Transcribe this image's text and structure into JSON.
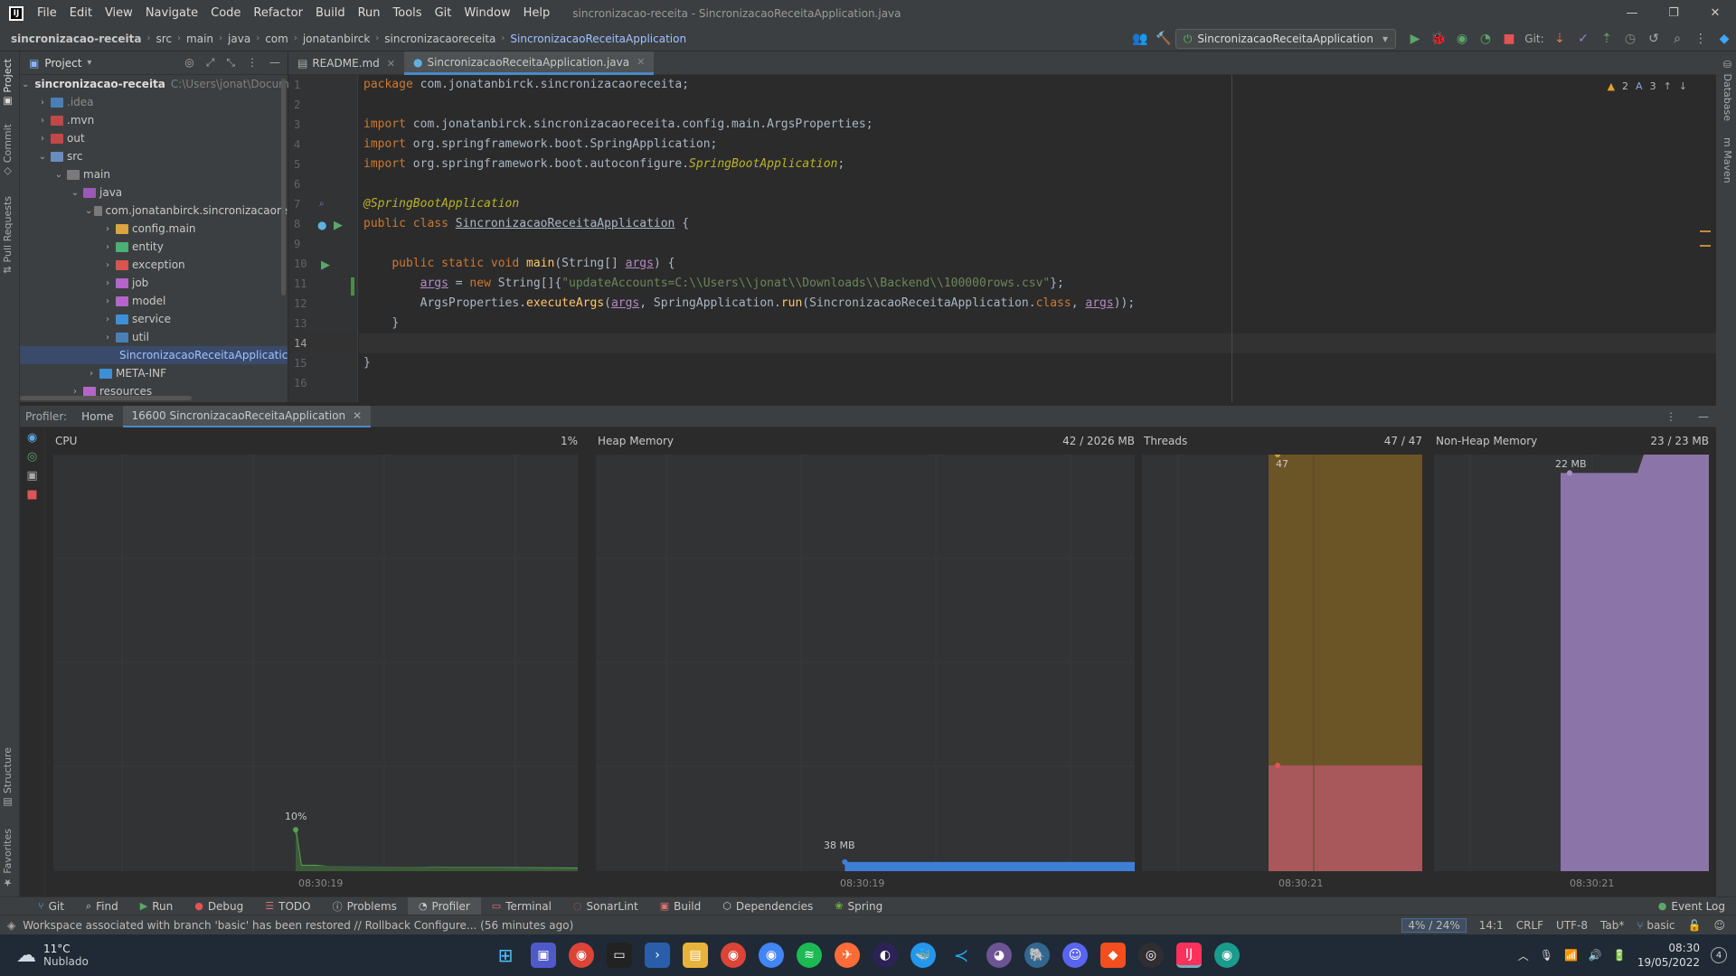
{
  "menu": {
    "items": [
      "File",
      "Edit",
      "View",
      "Navigate",
      "Code",
      "Refactor",
      "Build",
      "Run",
      "Tools",
      "Git",
      "Window",
      "Help"
    ],
    "window_title": "sincronizacao-receita - SincronizacaoReceitaApplication.java"
  },
  "breadcrumbs": [
    "sincronizacao-receita",
    "src",
    "main",
    "java",
    "com",
    "jonatanbirck",
    "sincronizacaoreceita",
    "SincronizacaoReceitaApplication"
  ],
  "toolbar": {
    "run_config": "SincronizacaoReceitaApplication",
    "git_label": "Git:"
  },
  "project": {
    "title": "Project",
    "root_name": "sincronizacao-receita",
    "root_path": "C:\\Users\\jonat\\Docume",
    "items": [
      {
        "label": ".idea"
      },
      {
        "label": ".mvn"
      },
      {
        "label": "out"
      },
      {
        "label": "src"
      },
      {
        "label": "main"
      },
      {
        "label": "java"
      },
      {
        "label": "com.jonatanbirck.sincronizacaore"
      },
      {
        "label": "config.main"
      },
      {
        "label": "entity"
      },
      {
        "label": "exception"
      },
      {
        "label": "job"
      },
      {
        "label": "model"
      },
      {
        "label": "service"
      },
      {
        "label": "util"
      },
      {
        "label": "SincronizacaoReceitaApplicatic"
      },
      {
        "label": "META-INF"
      },
      {
        "label": "resources"
      }
    ]
  },
  "editor": {
    "tabs": [
      {
        "label": "README.md"
      },
      {
        "label": "SincronizacaoReceitaApplication.java"
      }
    ],
    "line_numbers": [
      "1",
      "2",
      "3",
      "4",
      "5",
      "6",
      "7",
      "8",
      "9",
      "10",
      "11",
      "12",
      "13",
      "14",
      "15",
      "16"
    ],
    "inspections": {
      "warnings": "2",
      "typos": "3"
    },
    "code": {
      "l1_kw": "package",
      "l1_rest": " com.jonatanbirck.sincronizacaoreceita;",
      "l3_kw": "import",
      "l3_rest": " com.jonatanbirck.sincronizacaoreceita.config.main.ArgsProperties;",
      "l4_kw": "import",
      "l4_rest": " org.springframework.boot.SpringApplication;",
      "l5_kw": "import",
      "l5_rest": " org.springframework.boot.autoconfigure.",
      "l5_it": "SpringBootApplication",
      "l5_end": ";",
      "l7_ann": "@SpringBootApplication",
      "l8_kw": "public class",
      "l8_cls": "SincronizacaoReceitaApplication",
      "l8_end": " {",
      "l10_kw": "public static void",
      "l10_fn": " main",
      "l10_a": "(String[] ",
      "l10_prm": "args",
      "l10_end": ") {",
      "l11_prm": "args",
      "l11_a": " = ",
      "l11_kw": "new",
      "l11_b": " String[]{",
      "l11_str": "\"updateAccounts=C:\\\\Users\\\\jonat\\\\Downloads\\\\Backend\\\\100000rows.csv\"",
      "l11_end": "};",
      "l12_a": "ArgsProperties.",
      "l12_fn": "executeArgs",
      "l12_b": "(",
      "l12_prm": "args",
      "l12_c": ", SpringApplication.",
      "l12_fn2": "run",
      "l12_d": "(SincronizacaoReceitaApplication.",
      "l12_kw": "class",
      "l12_e": ", ",
      "l12_prm2": "args",
      "l12_end": "));",
      "l13": "}",
      "l15": "}"
    }
  },
  "profiler": {
    "label": "Profiler:",
    "tabs": [
      {
        "label": "Home"
      },
      {
        "label": "16600 SincronizacaoReceitaApplication"
      }
    ],
    "panels": {
      "cpu": {
        "title": "CPU",
        "value": "1%",
        "peak_label": "10%",
        "time": "08:30:19"
      },
      "heap": {
        "title": "Heap Memory",
        "value": "42 / 2026 MB",
        "peak_label": "38 MB",
        "time": "08:30:19"
      },
      "threads": {
        "title": "Threads",
        "value": "47 / 47",
        "peak_label": "47",
        "time": "08:30:21"
      },
      "nonheap": {
        "title": "Non-Heap Memory",
        "value": "23 / 23 MB",
        "peak_label": "22 MB",
        "time": "08:30:21"
      }
    },
    "colors": {
      "cpu": "#5a9e52",
      "heap": "#3e7fd6",
      "threads_upper": "#6b5426",
      "threads_lower": "#a8585a",
      "nonheap": "#8a74a8"
    }
  },
  "bottom_tabs": [
    "Git",
    "Find",
    "Run",
    "Debug",
    "TODO",
    "Problems",
    "Profiler",
    "Terminal",
    "SonarLint",
    "Build",
    "Dependencies",
    "Spring"
  ],
  "event_log": "Event Log",
  "status": {
    "message": "Workspace associated with branch 'basic' has been restored // Rollback   Configure... (56 minutes ago)",
    "memory": "4% / 24%",
    "position": "14:1",
    "line_sep": "CRLF",
    "encoding": "UTF-8",
    "indent": "Tab*",
    "branch": "basic"
  },
  "taskbar": {
    "temp": "11°C",
    "weather": "Nublado",
    "time": "08:30",
    "date": "19/05/2022",
    "notif": "4"
  }
}
